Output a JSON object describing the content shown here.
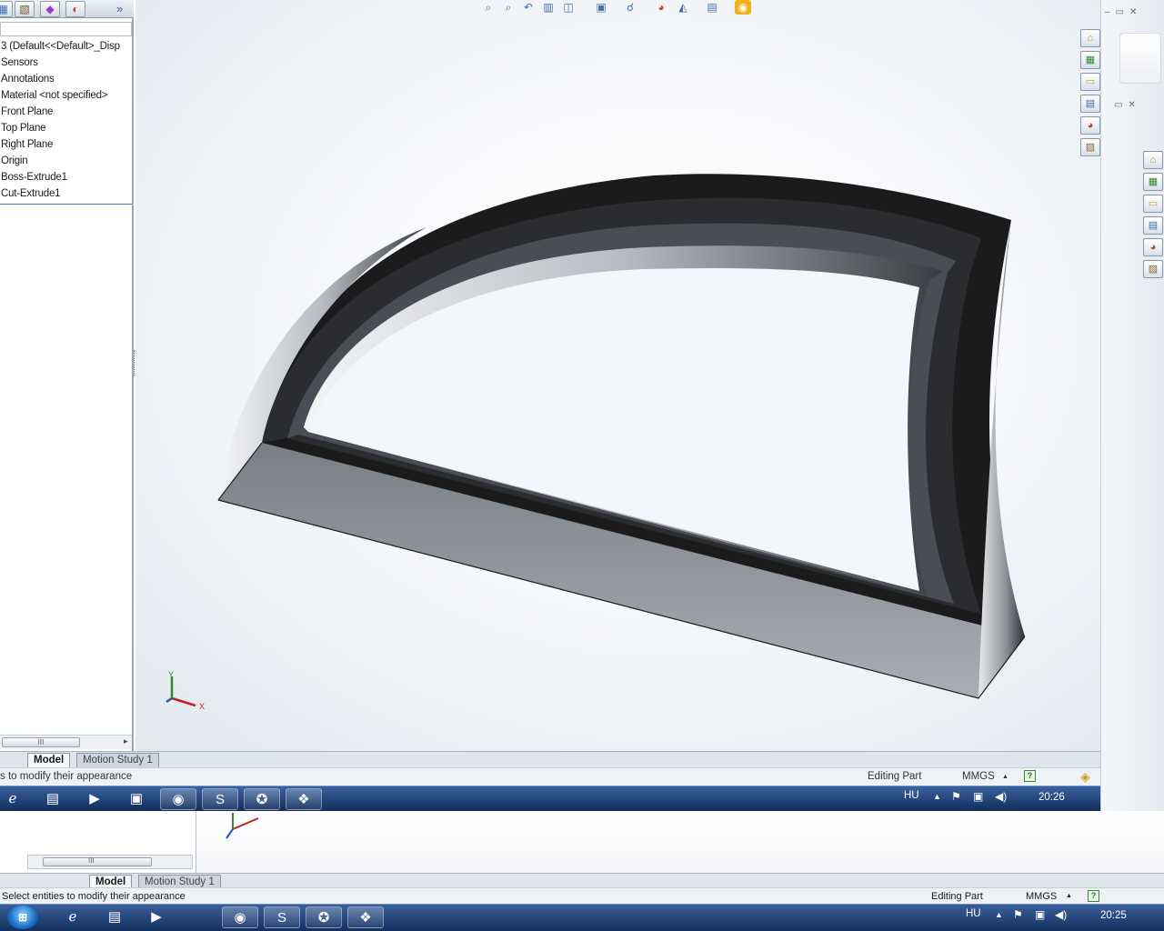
{
  "feature_tree": {
    "items": [
      "3  (Default<<Default>_Disp",
      "Sensors",
      "Annotations",
      "Material <not specified>",
      "Front Plane",
      "Top Plane",
      "Right Plane",
      "Origin",
      "Boss-Extrude1",
      "Cut-Extrude1"
    ],
    "expand_glyph": "»"
  },
  "tabs": {
    "model": "Model",
    "motion_study": "Motion Study 1"
  },
  "status_bar": {
    "hint_inner": "s to modify their appearance",
    "hint_outer": "Select entities to modify their appearance",
    "mode": "Editing Part",
    "units": "MMGS",
    "units_arrow": "▲",
    "help": "?"
  },
  "taskbar": {
    "language": "HU",
    "time_inner": "20:26",
    "time_outer": "20:25"
  },
  "triad": {
    "x": "X",
    "y": "Y"
  },
  "scroll_grip": "III",
  "colors": {
    "taskbar": "#1c3f78",
    "selection_line": "#4a78c0",
    "model_edge": "#1b1b1b"
  }
}
